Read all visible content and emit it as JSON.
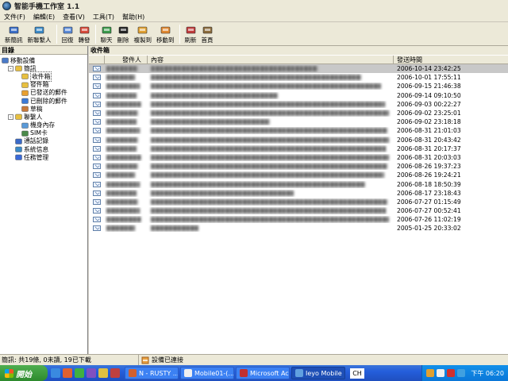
{
  "window": {
    "title": "智能手機工作室 1.1"
  },
  "menu": [
    "文件(F)",
    "編輯(E)",
    "查看(V)",
    "工具(T)",
    "幫助(H)"
  ],
  "toolbar": [
    {
      "label": "新簡訊",
      "icon": "new-sms-icon",
      "color": "#3a6ec8"
    },
    {
      "label": "新聯繫人",
      "icon": "new-contact-icon",
      "color": "#3a8ac8"
    },
    {
      "sep": true
    },
    {
      "label": "回復",
      "icon": "reply-icon",
      "color": "#5a8ad8"
    },
    {
      "label": "轉發",
      "icon": "forward-icon",
      "color": "#d84a3a"
    },
    {
      "sep": true
    },
    {
      "label": "聊天",
      "icon": "chat-icon",
      "color": "#3a9a4a"
    },
    {
      "label": "刪除",
      "icon": "delete-icon",
      "color": "#222222"
    },
    {
      "label": "複製到",
      "icon": "copy-to-icon",
      "color": "#e0a030"
    },
    {
      "label": "移動到",
      "icon": "move-to-icon",
      "color": "#e08830"
    },
    {
      "sep": true
    },
    {
      "label": "刷新",
      "icon": "refresh-icon",
      "color": "#c03a3a"
    },
    {
      "label": "首頁",
      "icon": "home-icon",
      "color": "#8a6a3a"
    }
  ],
  "left_panel": {
    "header": "目錄",
    "tree": [
      {
        "label": "移動設備",
        "level": 0,
        "icon": "mobile-device-icon",
        "expander": "",
        "color": "#4a7ac8"
      },
      {
        "label": "簡訊",
        "level": 1,
        "icon": "sms-folder-icon",
        "expander": "-",
        "color": "#e8c040"
      },
      {
        "label": "收件箱",
        "level": 2,
        "icon": "inbox-icon",
        "expander": "",
        "color": "#e8c040",
        "selected": true
      },
      {
        "label": "發件箱",
        "level": 2,
        "icon": "outbox-icon",
        "expander": "",
        "color": "#e8c040"
      },
      {
        "label": "已發送的郵件",
        "level": 2,
        "icon": "sent-icon",
        "expander": "",
        "color": "#e8a030"
      },
      {
        "label": "已刪除的郵件",
        "level": 2,
        "icon": "deleted-icon",
        "expander": "",
        "color": "#3a7ad8"
      },
      {
        "label": "草稿",
        "level": 2,
        "icon": "drafts-icon",
        "expander": "",
        "color": "#c87a3a"
      },
      {
        "label": "聯繫人",
        "level": 1,
        "icon": "contacts-folder-icon",
        "expander": "-",
        "color": "#e8c040"
      },
      {
        "label": "機身內存",
        "level": 2,
        "icon": "phone-memory-icon",
        "expander": "",
        "color": "#5a9ad8"
      },
      {
        "label": "SIM卡",
        "level": 2,
        "icon": "sim-card-icon",
        "expander": "",
        "color": "#4a8a4a"
      },
      {
        "label": "通話記錄",
        "level": 1,
        "icon": "call-log-icon",
        "expander": "",
        "color": "#3a6ac8"
      },
      {
        "label": "系統信息",
        "level": 1,
        "icon": "system-info-icon",
        "expander": "",
        "color": "#3a8ac8"
      },
      {
        "label": "任務管理",
        "level": 1,
        "icon": "task-manager-icon",
        "expander": "",
        "color": "#3a6ad8"
      }
    ]
  },
  "right_panel": {
    "header": "收件箱",
    "columns": [
      "發件人",
      "內容",
      "發送時間"
    ],
    "rows": [
      {
        "time": "2006-10-14 23:42:25",
        "sender_w": 40,
        "content_w": 210,
        "selected": true
      },
      {
        "time": "2006-10-01 17:55:11",
        "sender_w": 36,
        "content_w": 265
      },
      {
        "time": "2006-09-15 21:46:38",
        "sender_w": 42,
        "content_w": 290
      },
      {
        "time": "2006-09-14 09:10:50",
        "sender_w": 38,
        "content_w": 160
      },
      {
        "time": "2006-09-03 00:22:27",
        "sender_w": 44,
        "content_w": 295
      },
      {
        "time": "2006-09-02 23:25:01",
        "sender_w": 40,
        "content_w": 300
      },
      {
        "time": "2006-09-02 23:18:18",
        "sender_w": 38,
        "content_w": 150
      },
      {
        "time": "2006-08-31 21:01:03",
        "sender_w": 42,
        "content_w": 298
      },
      {
        "time": "2006-08-31 20:43:42",
        "sender_w": 40,
        "content_w": 300
      },
      {
        "time": "2006-08-31 20:17:37",
        "sender_w": 38,
        "content_w": 296
      },
      {
        "time": "2006-08-31 20:03:03",
        "sender_w": 44,
        "content_w": 300
      },
      {
        "time": "2006-08-26 19:37:23",
        "sender_w": 40,
        "content_w": 298
      },
      {
        "time": "2006-08-26 19:24:21",
        "sender_w": 36,
        "content_w": 294
      },
      {
        "time": "2006-08-18 18:50:39",
        "sender_w": 42,
        "content_w": 270
      },
      {
        "time": "2006-08-17 23:18:43",
        "sender_w": 38,
        "content_w": 180
      },
      {
        "time": "2006-07-27 01:15:49",
        "sender_w": 40,
        "content_w": 298
      },
      {
        "time": "2006-07-27 00:52:41",
        "sender_w": 42,
        "content_w": 296
      },
      {
        "time": "2006-07-26 11:02:19",
        "sender_w": 44,
        "content_w": 300
      },
      {
        "time": "2005-01-25 20:33:02",
        "sender_w": 36,
        "content_w": 60
      }
    ]
  },
  "statusbar": {
    "left": "簡訊: 共19條, 0未讀, 19已下載",
    "right": "設備已連接"
  },
  "taskbar": {
    "start": "開始",
    "tasks": [
      {
        "label": "N - RUSTY ...",
        "color": "#d06030",
        "active": false
      },
      {
        "label": "Mobile01-(...",
        "color": "#f0f0f0",
        "active": false
      },
      {
        "label": "Microsoft Ac...",
        "color": "#c03030",
        "active": false
      },
      {
        "label": "Ieyo Mobile ...",
        "color": "#60a0e0",
        "active": true
      }
    ],
    "lang": "CH",
    "clock": "下午 06:20"
  }
}
